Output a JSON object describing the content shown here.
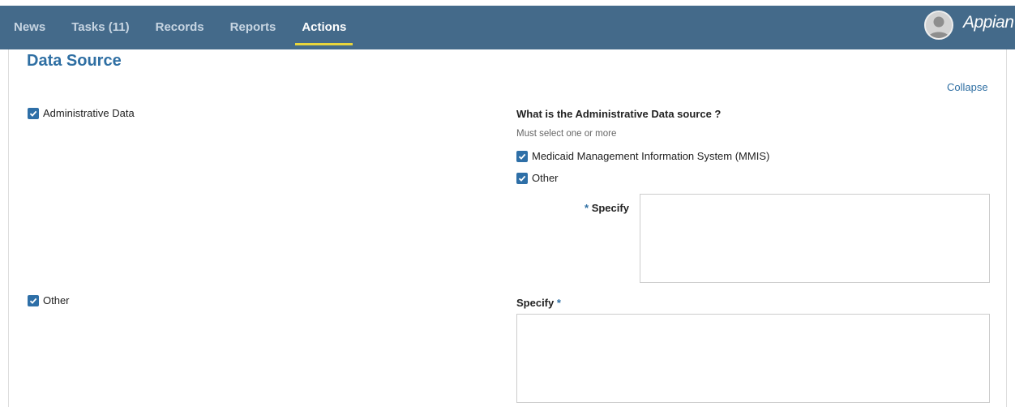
{
  "nav": {
    "items": [
      {
        "label": "News"
      },
      {
        "label": "Tasks (11)"
      },
      {
        "label": "Records"
      },
      {
        "label": "Reports"
      },
      {
        "label": "Actions"
      }
    ],
    "active_index": 4,
    "brand": "Appian",
    "accent_color": "#e8d53c",
    "bar_color": "#446a8a"
  },
  "section": {
    "title": "Data Source",
    "collapse_label": "Collapse"
  },
  "left": {
    "admin_checkbox": {
      "label": "Administrative Data",
      "checked": true
    },
    "other_checkbox": {
      "label": "Other",
      "checked": true
    }
  },
  "right": {
    "question": "What is the Administrative Data source ?",
    "hint": "Must select one or more",
    "options": [
      {
        "label": "Medicaid Management Information System (MMIS)",
        "checked": true
      },
      {
        "label": "Other",
        "checked": true
      }
    ],
    "specify_inline": {
      "required_mark": "*",
      "label": "Specify",
      "value": ""
    },
    "specify_bottom": {
      "label": "Specify",
      "required_mark": "*",
      "value": ""
    }
  },
  "icons": {
    "checkbox": "checkmark-icon",
    "avatar": "user-avatar-icon"
  }
}
